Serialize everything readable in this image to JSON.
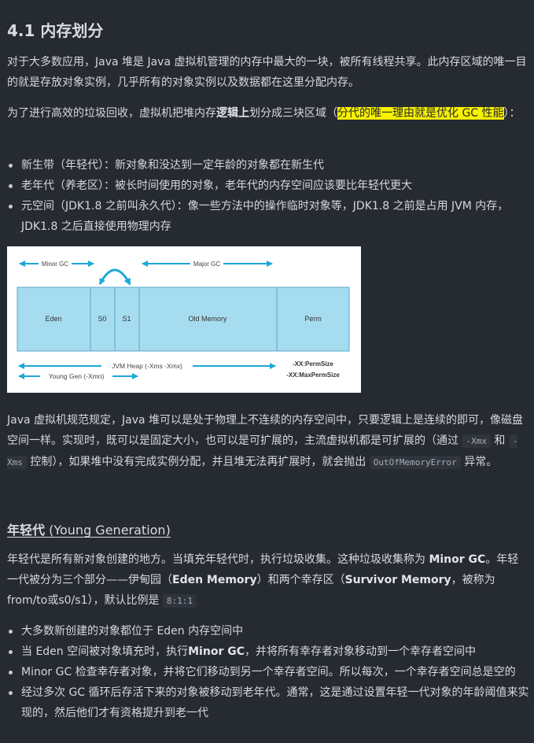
{
  "heading": "4.1 内存划分",
  "para1": "对于大多数应用，Java 堆是 Java 虚拟机管理的内存中最大的一块，被所有线程共享。此内存区域的唯一目的就是存放对象实例，几乎所有的对象实例以及数据都在这里分配内存。",
  "para2": {
    "pre": "为了进行高效的垃圾回收，虚拟机把堆内存",
    "bold": "逻辑上",
    "mid": "划分成三块区域（",
    "highlight": "分代的唯一理由就是优化 GC 性能",
    "post": "）："
  },
  "list1": [
    "新生带（年轻代）：新对象和没达到一定年龄的对象都在新生代",
    "老年代（养老区）：被长时间使用的对象，老年代的内存空间应该要比年轻代更大",
    "元空间（JDK1.8 之前叫永久代）：像一些方法中的操作临时对象等，JDK1.8 之前是占用 JVM 内存，JDK1.8 之后直接使用物理内存"
  ],
  "figure": {
    "minor_gc": "Minor GC",
    "major_gc": "Major GC",
    "eden": "Eden",
    "s0": "S0",
    "s1": "S1",
    "old": "Old Memory",
    "perm": "Perm",
    "heap": "JVM Heap (-Xms -Xmx)",
    "young": "Young Gen (-Xmn)",
    "perm_size": "-XX:PermSize",
    "max_perm_size": "-XX:MaxPermSize",
    "box_fill": "#a6dcef"
  },
  "para3": {
    "t1": "Java 虚拟机规范规定，Java 堆可以是处于物理上不连续的内存空间中，只要逻辑上是连续的即可，像磁盘空间一样。实现时，既可以是固定大小，也可以是可扩展的，主流虚拟机都是可扩展的（通过 ",
    "c1": "-Xmx",
    "t2": " 和 ",
    "c2": "-Xms",
    "t3": " 控制），如果堆中没有完成实例分配，并且堆无法再扩展时，就会抛出 ",
    "c3": "OutOfMemoryError",
    "t4": " 异常。"
  },
  "heading2": {
    "cn": "年轻代",
    "en": " (Young Generation)"
  },
  "para4": {
    "t1": "年轻代是所有新对象创建的地方。当填充年轻代时，执行垃圾收集。这种垃圾收集称为 ",
    "b1": "Minor GC",
    "t2": "。年轻一代被分为三个部分——伊甸园（",
    "b2": "Eden Memory",
    "t3": "）和两个幸存区（",
    "b3": "Survivor Memory",
    "t4": "，被称为from/to或s0/s1），默认比例是 ",
    "c1": "8:1:1"
  },
  "list2": [
    {
      "t1": "大多数新创建的对象都位于 Eden 内存空间中"
    },
    {
      "t1": "当 Eden 空间被对象填充时，执行",
      "b1": "Minor GC",
      "t2": "，并将所有幸存者对象移动到一个幸存者空间中"
    },
    {
      "t1": "Minor GC 检查幸存者对象，并将它们移动到另一个幸存者空间。所以每次，一个幸存者空间总是空的"
    },
    {
      "t1": "经过多次 GC 循环后存活下来的对象被移动到老年代。通常，这是通过设置年轻一代对象的年龄阈值来实现的，然后他们才有资格提升到老一代"
    }
  ]
}
